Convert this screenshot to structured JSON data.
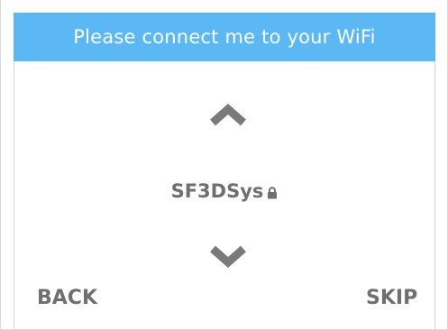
{
  "header": {
    "title": "Please connect me to your WiFi"
  },
  "wifi": {
    "network_name": "SF3DSys",
    "secured": true,
    "lock_icon": "lock-icon",
    "up_icon": "chevron-up-icon",
    "down_icon": "chevron-down-icon"
  },
  "nav": {
    "back_label": "BACK",
    "skip_label": "SKIP"
  },
  "colors": {
    "header_bg": "#5bb8f5",
    "header_text": "#ffffff",
    "text_gray": "#6f6f6f",
    "chevron_gray": "#7a7a7a"
  }
}
